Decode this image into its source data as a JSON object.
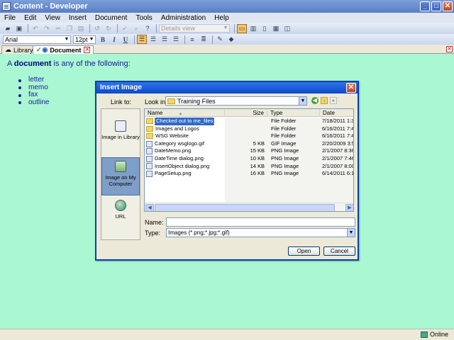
{
  "window": {
    "title": "Content - Developer"
  },
  "menu": [
    "File",
    "Edit",
    "View",
    "Insert",
    "Document",
    "Tools",
    "Administration",
    "Help"
  ],
  "toolbar": {
    "view_select": "Details view"
  },
  "format": {
    "font": "Arial",
    "size": "12pt",
    "bold": "B",
    "italic": "I",
    "underline": "U"
  },
  "tabs": [
    {
      "label": "Library"
    },
    {
      "label": "Document"
    }
  ],
  "document": {
    "intro_prefix": "A ",
    "intro_bold": "document",
    "intro_suffix": " is any of the following:",
    "items": [
      "letter",
      "memo",
      "fax",
      "outline"
    ]
  },
  "status": {
    "text": "Online"
  },
  "dialog": {
    "title": "Insert Image",
    "link_to_label": "Link to:",
    "look_in_label": "Look in:",
    "look_in_value": "Training Files",
    "places": [
      {
        "label": "Image in Library"
      },
      {
        "label": "Image on My Computer"
      },
      {
        "label": "URL"
      }
    ],
    "columns": {
      "name": "Name",
      "size": "Size",
      "type": "Type",
      "modified": "Date Modified"
    },
    "files": [
      {
        "name": "Checked out to me_files",
        "size": "",
        "type": "File Folder",
        "modified": "7/18/2011 1:3",
        "kind": "folder"
      },
      {
        "name": "Images and Logos",
        "size": "",
        "type": "File Folder",
        "modified": "6/16/2011 7:4",
        "kind": "folder"
      },
      {
        "name": "WSG Website",
        "size": "",
        "type": "File Folder",
        "modified": "6/16/2011 7:4",
        "kind": "folder"
      },
      {
        "name": "Category wsglogo.gif",
        "size": "5 KB",
        "type": "GIF Image",
        "modified": "2/20/2009 3:5",
        "kind": "file"
      },
      {
        "name": "DateMemo.png",
        "size": "15 KB",
        "type": "PNG Image",
        "modified": "2/1/2007 8:36",
        "kind": "file"
      },
      {
        "name": "DateTime dialog.png",
        "size": "10 KB",
        "type": "PNG Image",
        "modified": "2/1/2007 7:46",
        "kind": "file"
      },
      {
        "name": "InsertObject dialog.png",
        "size": "14 KB",
        "type": "PNG Image",
        "modified": "2/1/2007 8:00",
        "kind": "file"
      },
      {
        "name": "PageSetup.png",
        "size": "16 KB",
        "type": "PNG Image",
        "modified": "6/14/2011 6:1",
        "kind": "file"
      }
    ],
    "name_label": "Name:",
    "name_value": "",
    "type_label": "Type:",
    "type_value": "Images (*.png;*.jpg;*.gif)",
    "open_label": "Open",
    "cancel_label": "Cancel"
  }
}
